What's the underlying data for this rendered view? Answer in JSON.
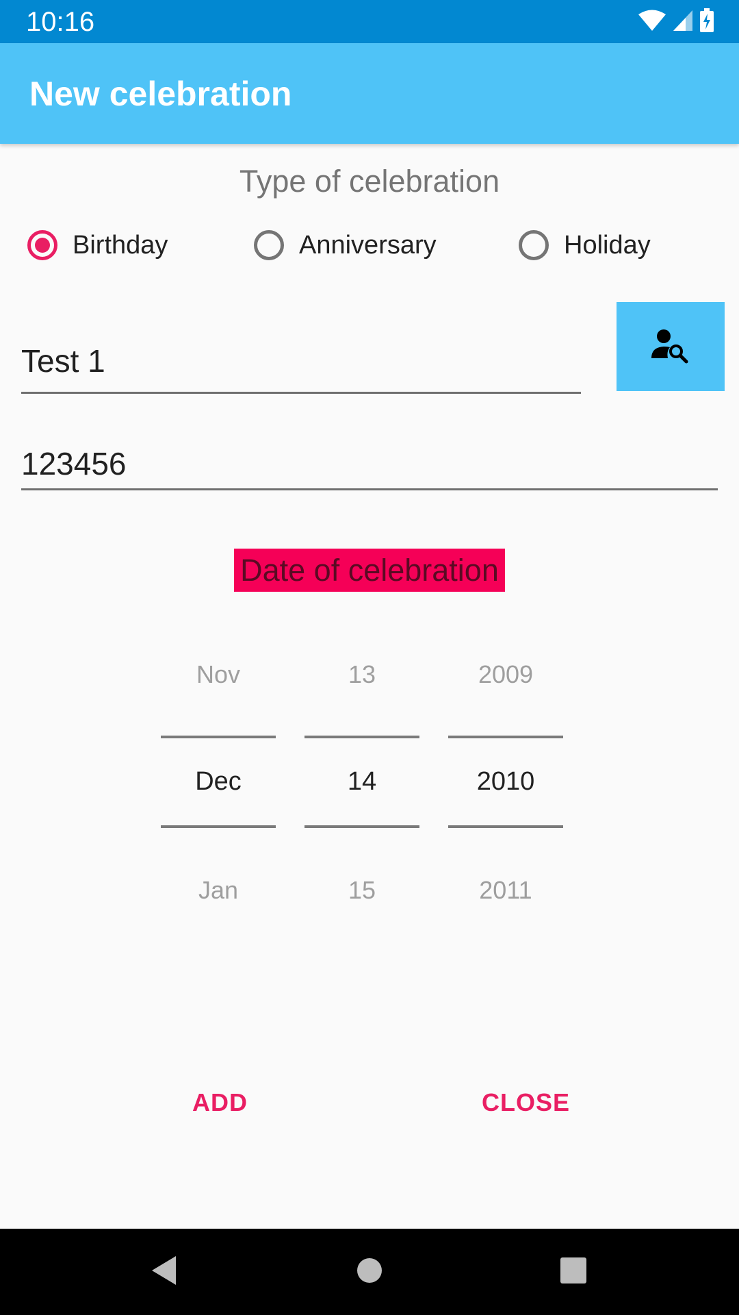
{
  "status_bar": {
    "time": "10:16",
    "icons": [
      "wifi-icon",
      "signal-icon",
      "battery-charging-icon"
    ]
  },
  "app_bar": {
    "title": "New celebration",
    "color": "#4fc3f7"
  },
  "form": {
    "type_title": "Type of celebration",
    "types": [
      {
        "label": "Birthday",
        "selected": true
      },
      {
        "label": "Anniversary",
        "selected": false
      },
      {
        "label": "Holiday",
        "selected": false
      }
    ],
    "name_value": "Test 1",
    "number_value": "123456",
    "contact_button_icon": "contact-search-icon",
    "date_title": "Date of celebration"
  },
  "date_picker": {
    "month": {
      "prev": "Nov",
      "current": "Dec",
      "next": "Jan"
    },
    "day": {
      "prev": "13",
      "current": "14",
      "next": "15"
    },
    "year": {
      "prev": "2009",
      "current": "2010",
      "next": "2011"
    }
  },
  "actions": {
    "add_label": "ADD",
    "close_label": "CLOSE",
    "accent": "#e91e63"
  },
  "nav_bar": {
    "icons": [
      "back-icon",
      "home-icon",
      "recents-icon"
    ]
  }
}
